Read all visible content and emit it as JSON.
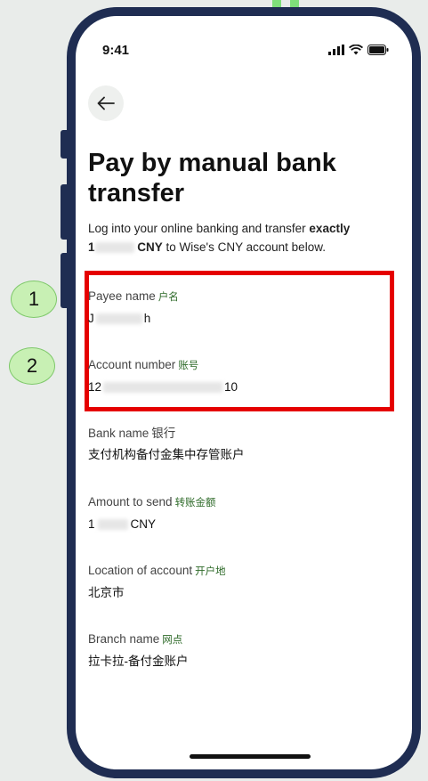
{
  "status_bar": {
    "time": "9:41"
  },
  "header": {
    "title": "Pay by manual bank transfer"
  },
  "intro": {
    "prefix": "Log into your online banking and transfer ",
    "emphasis": "exactly",
    "amount_start": "1",
    "currency": "CNY",
    "suffix": " to Wise's CNY account below."
  },
  "fields": {
    "payee_name": {
      "label": "Payee name",
      "label_cn": "户名",
      "value_start": "J",
      "value_end": "h"
    },
    "account_number": {
      "label": "Account number",
      "label_cn": "账号",
      "value_start": "12",
      "value_end": "10"
    },
    "bank_name": {
      "label": "Bank name",
      "label_cn": "银行",
      "value": "支付机构备付金集中存管账户"
    },
    "amount_to_send": {
      "label": "Amount to send",
      "label_cn": "转账金额",
      "value_start": "1",
      "value_end": "CNY"
    },
    "location": {
      "label": "Location of account",
      "label_cn": "开户地",
      "value": "北京市"
    },
    "branch_name": {
      "label": "Branch name",
      "label_cn": "网点",
      "value": "拉卡拉-备付金账户"
    }
  },
  "callouts": {
    "first": "1",
    "second": "2"
  },
  "colors": {
    "phone_frame": "#1f2d52",
    "highlight_border": "#e50000",
    "callout_fill": "#c8f0b4",
    "label_cn": "#2f6b2a"
  }
}
